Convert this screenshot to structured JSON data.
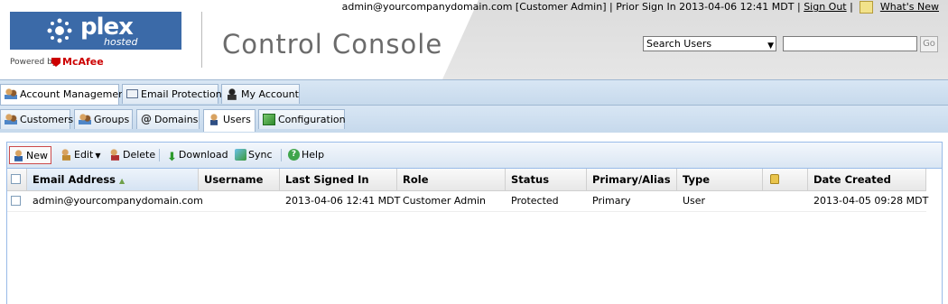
{
  "header": {
    "logo_text": "plex",
    "logo_sub": "hosted",
    "powered_by": "Powered by",
    "mcafee": "McAfee",
    "title": "Control Console",
    "user_info": "admin@yourcompanydomain.com [Customer Admin] | Prior Sign In 2013-04-06 12:41 MDT |",
    "sign_out": "Sign Out",
    "sep": "|",
    "whats_new": "What's New",
    "search_select": "Search Users",
    "search_value": "",
    "go": "Go"
  },
  "tabs_primary": [
    {
      "label": "Account Management",
      "icon": "users-icon",
      "active": true
    },
    {
      "label": "Email Protection",
      "icon": "mail-icon",
      "active": false
    },
    {
      "label": "My Account",
      "icon": "spy-icon",
      "active": false
    }
  ],
  "tabs_secondary": [
    {
      "label": "Customers",
      "icon": "users-icon",
      "active": false
    },
    {
      "label": "Groups",
      "icon": "users-icon",
      "active": false
    },
    {
      "label": "Domains",
      "icon": "at-icon",
      "active": false
    },
    {
      "label": "Users",
      "icon": "user-icon",
      "active": true
    },
    {
      "label": "Configuration",
      "icon": "cube-icon",
      "active": false
    }
  ],
  "toolbar": {
    "new": "New",
    "edit": "Edit",
    "delete": "Delete",
    "download": "Download",
    "sync": "Sync",
    "help": "Help"
  },
  "grid": {
    "columns": [
      "Email Address",
      "Username",
      "Last Signed In",
      "Role",
      "Status",
      "Primary/Alias",
      "Type",
      "",
      "Date Created"
    ],
    "sorted_column": "Email Address",
    "rows": [
      {
        "email": "admin@yourcompanydomain.com",
        "username": "",
        "last_signed_in": "2013-04-06 12:41 MDT",
        "role": "Customer Admin",
        "status": "Protected",
        "primary_alias": "Primary",
        "type": "User",
        "locked": "",
        "date_created": "2013-04-05 09:28 MDT"
      }
    ]
  },
  "colors": {
    "brand_blue": "#3b6aa8",
    "tab_bg": "#c6d9ec",
    "panel_border": "#99bbe8",
    "new_outline": "#cc4a4a"
  }
}
